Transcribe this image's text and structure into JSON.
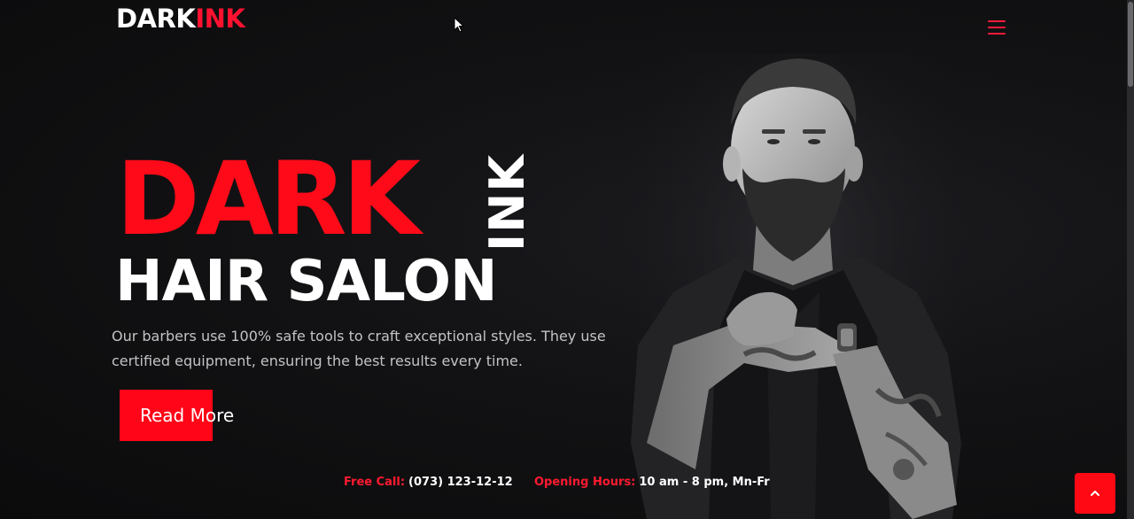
{
  "header": {
    "logo_part1": "DARK",
    "logo_part2": "INK",
    "menu_icon": "hamburger-menu-icon"
  },
  "hero": {
    "title_main": "DARK",
    "title_vertical": "INK",
    "subtitle": "HAIR SALON",
    "description": "Our barbers use 100% safe tools to craft exceptional styles. They use certified equipment, ensuring the best results every time.",
    "cta_label": "Read More"
  },
  "contact": {
    "call_label": "Free Call:",
    "call_value": "(073) 123-12-12",
    "hours_label": "Opening Hours:",
    "hours_value": "10 am - 8 pm, Mn-Fr"
  },
  "scroll_top_icon": "chevron-up-icon",
  "colors": {
    "accent": "#ff0a18",
    "background": "#121214",
    "text": "#ffffff",
    "muted_text": "#c3c3c6"
  }
}
